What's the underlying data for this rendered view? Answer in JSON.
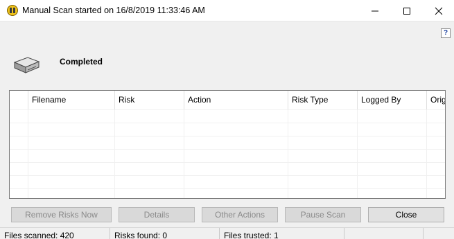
{
  "window": {
    "title": "Manual Scan started on 16/8/2019 11:33:46 AM"
  },
  "icons": {
    "app": "norton-shield-icon",
    "help": "help-icon",
    "drive": "hard-drive-icon"
  },
  "help": {
    "glyph": "?"
  },
  "scan": {
    "status": "Completed"
  },
  "table": {
    "columns": [
      "Filename",
      "Risk",
      "Action",
      "Risk Type",
      "Logged By",
      "Orig"
    ],
    "rows": []
  },
  "buttons": {
    "remove_risks": "Remove Risks Now",
    "details": "Details",
    "other_actions": "Other Actions",
    "pause_scan": "Pause Scan",
    "close": "Close"
  },
  "statusbar": {
    "files_scanned": "Files scanned: 420",
    "risks_found": "Risks found: 0",
    "files_trusted": "Files trusted: 1"
  },
  "colors": {
    "accent_yellow": "#f0c419",
    "help_blue": "#1a3f9e"
  }
}
